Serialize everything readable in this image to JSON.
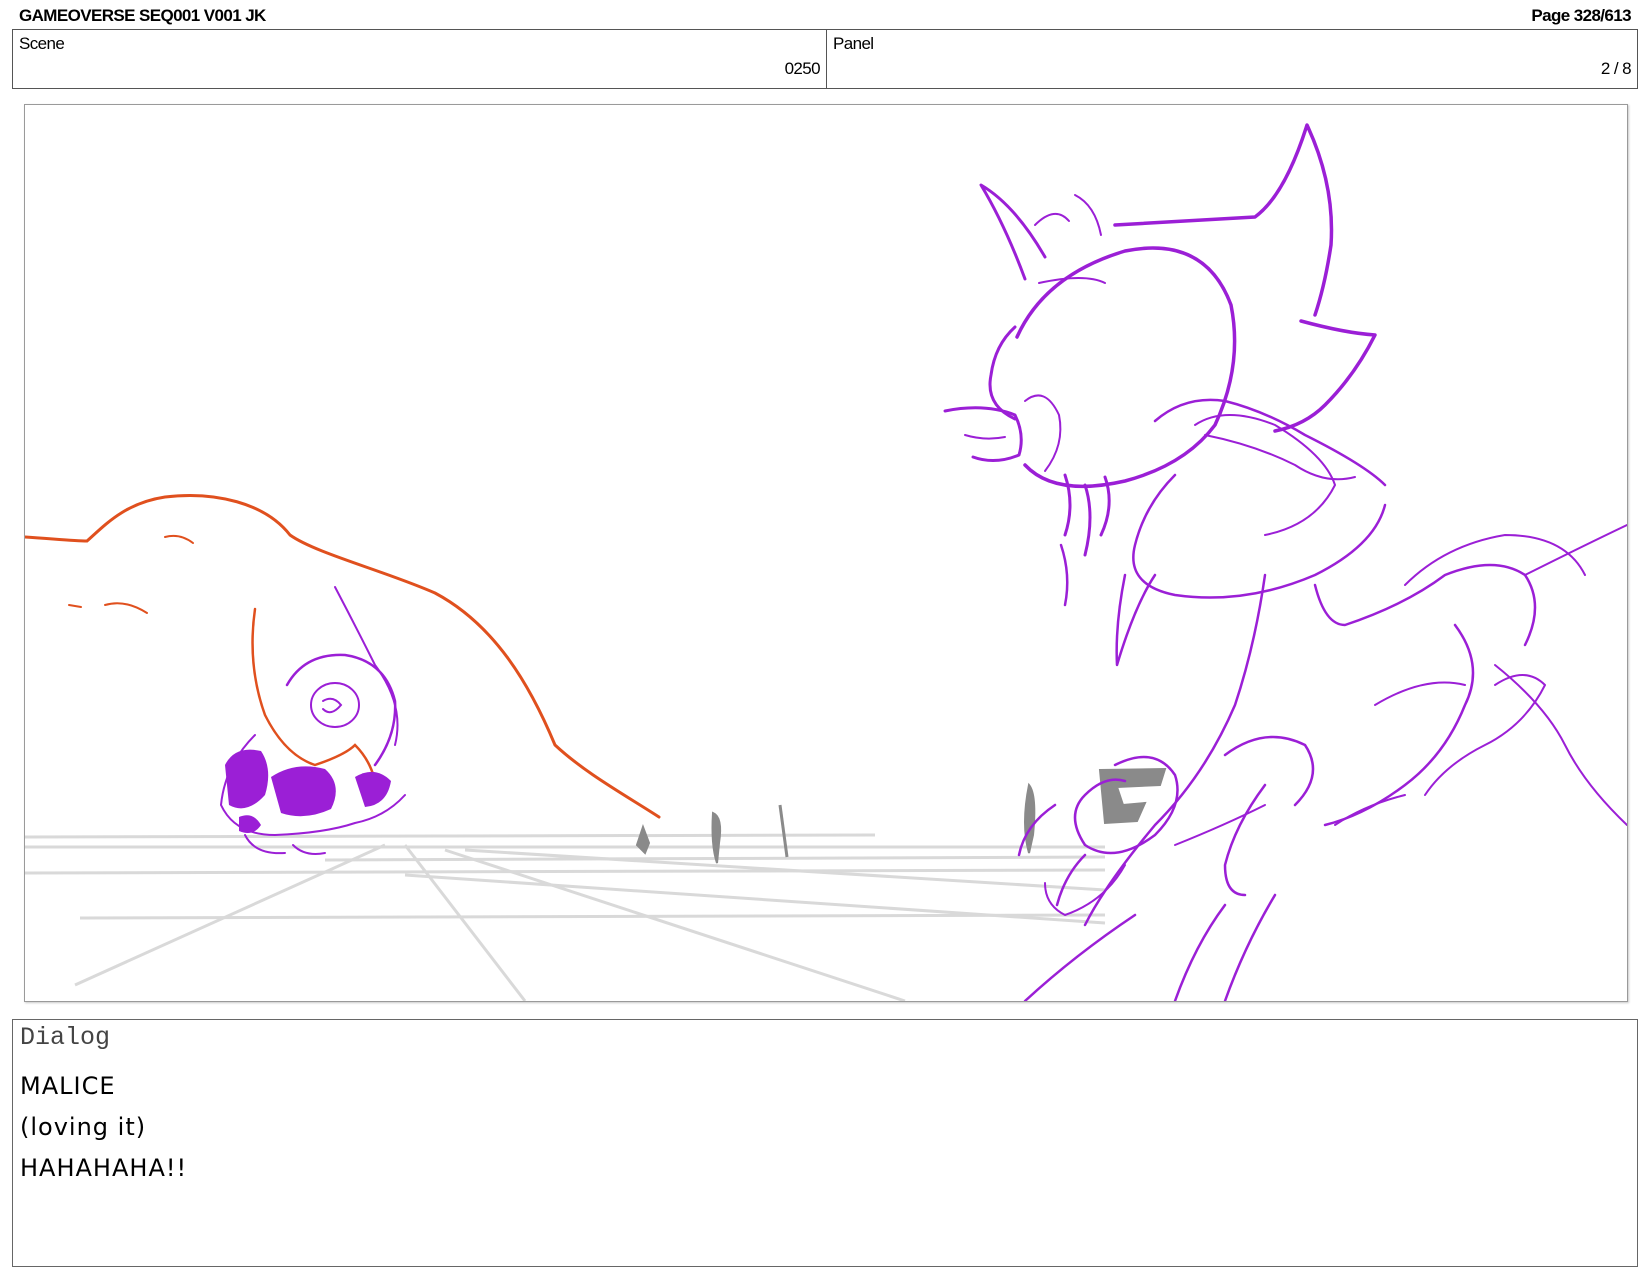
{
  "header": {
    "title": "GAMEOVERSE SEQ001 V001 JK",
    "page": "Page 328/613"
  },
  "info": {
    "scene_label": "Scene",
    "scene_value": "0250",
    "panel_label": "Panel",
    "panel_value": "2 / 8"
  },
  "colors": {
    "sketch_purple": "#9b1fd6",
    "sketch_orange": "#e0501e",
    "grid_gray": "#d9d9d9",
    "figure_gray": "#8a8a8a"
  },
  "dialog": {
    "label": "Dialog",
    "lines": [
      "MALICE",
      "(loving it)",
      "HAHAHAHA!!"
    ]
  }
}
